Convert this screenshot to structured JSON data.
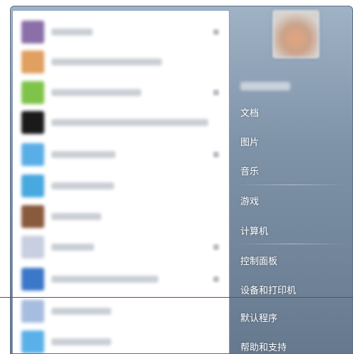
{
  "programs": [
    {
      "icon": "program-icon",
      "color": "#8a6fa8",
      "label_width": 58,
      "has_jump": true
    },
    {
      "icon": "program-icon",
      "color": "#e0a060",
      "label_width": 155,
      "has_jump": false
    },
    {
      "icon": "program-icon",
      "color": "#7fc44a",
      "label_width": 126,
      "has_jump": true
    },
    {
      "icon": "program-icon",
      "color": "#1a1a1a",
      "label_width": 220,
      "has_jump": false
    },
    {
      "icon": "program-icon",
      "color": "#5aaee8",
      "label_width": 90,
      "has_jump": true
    },
    {
      "icon": "program-icon",
      "color": "#48a8e0",
      "label_width": 88,
      "has_jump": false
    },
    {
      "icon": "program-icon",
      "color": "#8a5a3c",
      "label_width": 70,
      "has_jump": false
    },
    {
      "icon": "program-icon",
      "color": "#c8cfe0",
      "label_width": 60,
      "has_jump": true
    },
    {
      "icon": "program-icon",
      "color": "#3c78c8",
      "label_width": 150,
      "has_jump": true
    },
    {
      "icon": "program-icon",
      "color": "#a6bde0",
      "label_width": 84,
      "has_jump": false
    },
    {
      "icon": "program-icon",
      "color": "#5ab0e8",
      "label_width": 84,
      "has_jump": false
    }
  ],
  "places": {
    "documents": "文档",
    "pictures": "图片",
    "music": "音乐",
    "games": "游戏",
    "computer": "计算机",
    "control_panel": "控制面板",
    "devices_printers": "设备和打印机",
    "default_programs": "默认程序",
    "help_support": "帮助和支持"
  },
  "colors": {
    "right_pane_top": "#9fb2c6",
    "right_pane_bottom": "#66798e",
    "separator_line": "#b03030"
  }
}
